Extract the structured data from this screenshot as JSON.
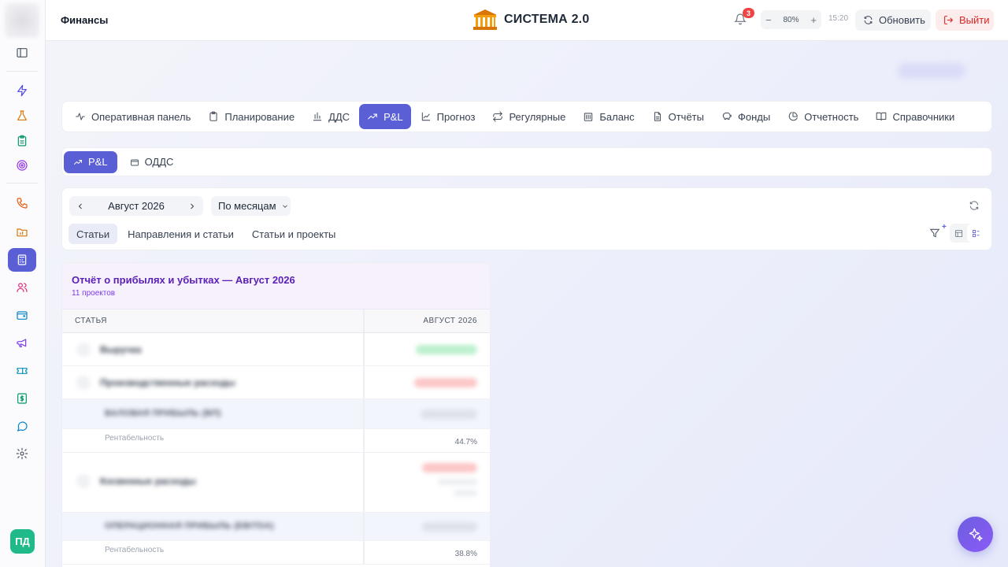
{
  "header": {
    "section_title": "Финансы",
    "brand_name": "СИСТЕМА 2.0",
    "notifications_count": "3",
    "zoom_minus": "−",
    "zoom_level": "80%",
    "zoom_plus": "+",
    "time": "15:20",
    "refresh_label": "Обновить",
    "logout_label": "Выйти"
  },
  "sidebar": {
    "icons": [
      "panel-icon",
      "lightning-icon",
      "flask-icon",
      "clipboard-icon",
      "target-icon",
      "phone-icon",
      "folder-chart-icon",
      "calculator-icon",
      "users-icon",
      "wallet-icon",
      "megaphone-icon",
      "ticket-icon",
      "dollar-icon",
      "chat-icon",
      "gear-icon"
    ],
    "active": "calculator-icon",
    "avatar_initials": "ПД"
  },
  "main_tabs": [
    {
      "label": "Оперативная панель",
      "icon": "activity-icon"
    },
    {
      "label": "Планирование",
      "icon": "clipboard-icon"
    },
    {
      "label": "ДДС",
      "icon": "bar-chart-icon"
    },
    {
      "label": "P&L",
      "icon": "trend-up-icon",
      "active": true
    },
    {
      "label": "Прогноз",
      "icon": "line-chart-icon"
    },
    {
      "label": "Регулярные",
      "icon": "repeat-icon"
    },
    {
      "label": "Баланс",
      "icon": "bank-icon"
    },
    {
      "label": "Отчёты",
      "icon": "file-icon"
    },
    {
      "label": "Фонды",
      "icon": "piggy-bank-icon"
    },
    {
      "label": "Отчетность",
      "icon": "pie-chart-icon"
    },
    {
      "label": "Справочники",
      "icon": "book-icon"
    }
  ],
  "sub_tabs": [
    {
      "label": "P&L",
      "icon": "trend-up-icon",
      "active": true
    },
    {
      "label": "ОДДС",
      "icon": "wallet-icon"
    }
  ],
  "filters": {
    "period": "Август 2026",
    "grouping": "По месяцам",
    "view_tabs": [
      {
        "label": "Статьи",
        "active": true
      },
      {
        "label": "Направления и статьи"
      },
      {
        "label": "Статьи и проекты"
      }
    ]
  },
  "report": {
    "title": "Отчёт о прибылях и убытках — Август 2026",
    "subtitle": "11 проектов",
    "col_article": "СТАТЬЯ",
    "col_period": "АВГУСТ 2026",
    "rows": [
      {
        "name": "Выручка",
        "tone": "green"
      },
      {
        "name": "Производственные расходы",
        "tone": "red"
      },
      {
        "name": "ВАЛОВАЯ ПРИБЫЛЬ (ВП)",
        "tone": "gray"
      },
      {
        "label": "Рентабельность",
        "value": "44.7%"
      },
      {
        "name": "Косвенные расходы",
        "tone": "red"
      },
      {
        "name": "ОПЕРАЦИОННАЯ ПРИБЫЛЬ (EBITDA)",
        "tone": "gray"
      },
      {
        "label": "Рентабельность",
        "value": "38.8%"
      }
    ]
  },
  "colors": {
    "accent": "#5b5fd6",
    "danger": "#dc2626",
    "report_title": "#5b21b6",
    "avatar": "#1fb98a"
  }
}
